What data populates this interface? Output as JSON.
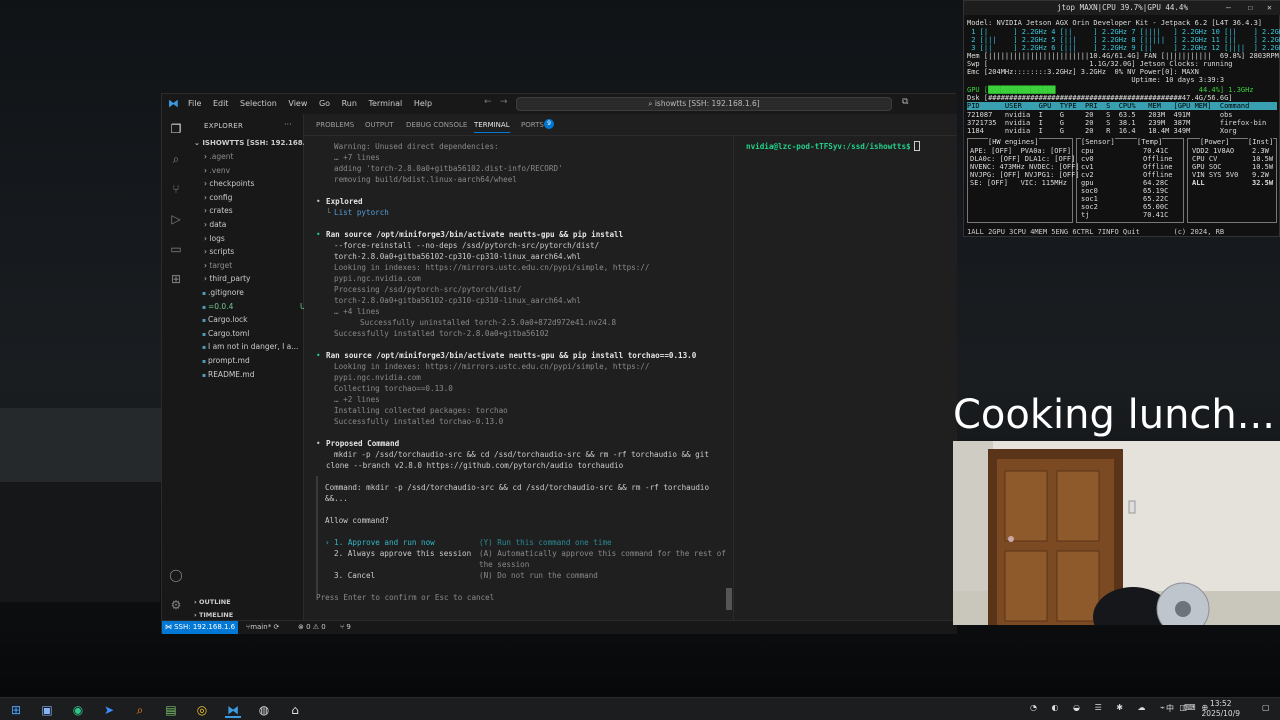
{
  "vscode": {
    "menu": [
      "File",
      "Edit",
      "Selection",
      "View",
      "Go",
      "Run",
      "Terminal",
      "Help"
    ],
    "search": "ishowtts [SSH: 192.168.1.6]",
    "explorer": {
      "title": "EXPLORER",
      "root": "ISHOWTTS [SSH: 192.168.1.6]",
      "items": [
        {
          "label": "agent",
          "prefix": "> ."
        },
        {
          "label": "venv",
          "prefix": "> ."
        },
        {
          "label": "checkpoints",
          "prefix": ">"
        },
        {
          "label": "config",
          "prefix": ">"
        },
        {
          "label": "crates",
          "prefix": ">"
        },
        {
          "label": "data",
          "prefix": ">"
        },
        {
          "label": "logs",
          "prefix": ">"
        },
        {
          "label": "scripts",
          "prefix": ">"
        },
        {
          "label": "target",
          "prefix": ">"
        },
        {
          "label": "third_party",
          "prefix": ">"
        },
        {
          "label": ".gitignore",
          "prefix": ""
        },
        {
          "label": "=0.0.4",
          "prefix": "",
          "badge": "U"
        },
        {
          "label": "Cargo.lock",
          "prefix": ""
        },
        {
          "label": "Cargo.toml",
          "prefix": ""
        },
        {
          "label": "I am not in danger, I a...",
          "prefix": ""
        },
        {
          "label": "prompt.md",
          "prefix": ""
        },
        {
          "label": "README.md",
          "prefix": ""
        }
      ],
      "outline": "OUTLINE",
      "timeline": "TIMELINE"
    },
    "panel_tabs": [
      "PROBLEMS",
      "OUTPUT",
      "DEBUG CONSOLE",
      "TERMINAL",
      "PORTS"
    ],
    "ports_badge": "9",
    "terminal_left": [
      "Warning: Unused direct dependencies:",
      "… +7 lines",
      "adding 'torch-2.8.0a0+gitba56102.dist-info/RECORD'",
      "removing build/bdist.linux-aarch64/wheel",
      "Explored",
      "List pytorch",
      "Ran source /opt/miniforge3/bin/activate neutts-gpu && pip install",
      "--force-reinstall --no-deps /ssd/pytorch-src/pytorch/dist/",
      "torch-2.8.0a0+gitba56102-cp310-cp310-linux_aarch64.whl",
      "Looking in indexes: https://mirrors.ustc.edu.cn/pypi/simple, https://",
      "pypi.ngc.nvidia.com",
      "Processing /ssd/pytorch-src/pytorch/dist/",
      "torch-2.8.0a0+gitba56102-cp310-cp310-linux_aarch64.whl",
      "… +4 lines",
      "Successfully uninstalled torch-2.5.0a0+872d972e41.nv24.8",
      "Successfully installed torch-2.8.0a0+gitba56102",
      "Ran source /opt/miniforge3/bin/activate neutts-gpu && pip install torchao==0.13.0",
      "Looking in indexes: https://mirrors.ustc.edu.cn/pypi/simple, https://",
      "pypi.ngc.nvidia.com",
      "Collecting torchao==0.13.0",
      "… +2 lines",
      "Installing collected packages: torchao",
      "Successfully installed torchao-0.13.0",
      "Proposed Command",
      "mkdir -p /ssd/torchaudio-src && cd /ssd/torchaudio-src && rm -rf torchaudio && git",
      "clone --branch v2.8.0 https://github.com/pytorch/audio torchaudio",
      "Command: mkdir -p /ssd/torchaudio-src && cd /ssd/torchaudio-src && rm -rf torchaudio",
      "&&...",
      "Allow command?",
      "› 1. Approve and run now",
      "(Y) Run this command one time",
      "2. Always approve this session",
      "(A) Automatically approve this command for the rest of",
      "the session",
      "3. Cancel",
      "(N) Do not run the command",
      "Press Enter to confirm or Esc to cancel"
    ],
    "terminal_right": "nvidia@lzc-pod-tTFSyv:/ssd/ishowtts$",
    "status": {
      "remote": "SSH: 192.168.1.6",
      "branch": "main*",
      "problems": "⊗ 0 ⚠ 0",
      "ports": "⑂ 9"
    }
  },
  "jtop": {
    "title": "jtop MAXN|CPU 39.7%|GPU 44.4%",
    "lines": [
      "Model: NVIDIA Jetson AGX Orin Developer Kit - Jetpack 6.2 [L4T 36.4.3]",
      " 1 [|      ] 2.2GHz 4 [||     ] 2.2GHz 7 [||||   ] 2.2GHz 10 [||    ] 2.2GHz",
      " 2 [|||    ] 2.2GHz 5 [|||    ] 2.2GHz 8 [|||||  ] 2.2GHz 11 [||    ] 2.2GHz",
      " 3 [||     ] 2.2GHz 6 [|||    ] 2.2GHz 9 [||     ] 2.2GHz 12 [||||  ] 2.2GHz",
      "Mem [||||||||||||||||||||||||10.4G/61.4G] FAN [|||||||||||  69.8%] 2803RPM",
      "Swp [                        1.1G/32.0G] Jetson Clocks: running",
      "Emc [204MHz::::::::3.2GHz] 3.2GHz  0% NV Power[0]: MAXN",
      "                                       Uptime: 10 days 3:39:3",
      "GPU [████████████████                                  44.4%] 1.3GHz",
      "Dsk [##############################################47.4G/56.6G]",
      "PID      USER    GPU  TYPE  PRI  S  CPU%   MEM   [GPU MEM]  Command",
      "721087   nvidia  I    G     20   S  63.5   203M  491M       obs",
      "3721735  nvidia  I    G     20   S  38.1   239M  387M       firefox-bin",
      "1184     nvidia  I    G     20   R  16.4   18.4M 349M       Xorg"
    ],
    "hw_engines": [
      "APE: [OFF]  PVA0a: [OFF]",
      "DLA0c: [OFF] DLA1c: [OFF]",
      "NVENC: 473MHz NVDEC: [OFF]",
      "NVJPG: [OFF] NVJPG1: [OFF]",
      "SE: [OFF]   VIC: 115MHz"
    ],
    "sensors": [
      [
        "cpu",
        "70.41C"
      ],
      [
        "cv0",
        "Offline"
      ],
      [
        "cv1",
        "Offline"
      ],
      [
        "cv2",
        "Offline"
      ],
      [
        "gpu",
        "64.28C"
      ],
      [
        "soc0",
        "65.19C"
      ],
      [
        "soc1",
        "65.22C"
      ],
      [
        "soc2",
        "65.00C"
      ],
      [
        "tj",
        "70.41C"
      ]
    ],
    "power": [
      [
        "VDD2 1V8AO",
        "2.3W"
      ],
      [
        "CPU CV",
        "10.5W"
      ],
      [
        "GPU SOC",
        "10.5W"
      ],
      [
        "VIN SYS 5V0",
        "9.2W"
      ],
      [
        "ALL",
        "32.5W"
      ]
    ],
    "headers": {
      "hw": "[HW engines]",
      "sensor": "[Sensor]",
      "temp": "[Temp]",
      "power": "[Power]",
      "inst": "[Inst]"
    },
    "footer": "1ALL 2GPU 3CPU 4MEM 5ENG 6CTRL 7INFO Quit        (c) 2024, RB"
  },
  "overlay": {
    "text": "Cooking lunch..."
  },
  "taskbar": {
    "time": "13:52",
    "date": "2025/10/9",
    "ime": "中"
  }
}
